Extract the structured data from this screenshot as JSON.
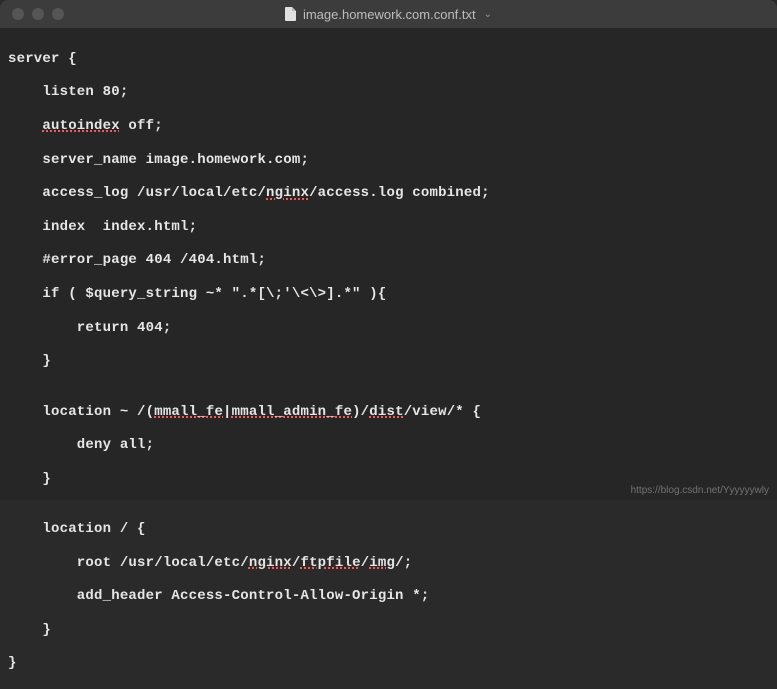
{
  "titlebar": {
    "filename": "image.homework.com.conf.txt",
    "chevron": "⌄"
  },
  "code": {
    "l0": "server {",
    "l1a": "    listen 80;",
    "l2a": "    ",
    "l2b": "autoindex",
    "l2c": " off;",
    "l3a": "    server_name image.homework.com;",
    "l4a": "    access_log /usr/local/etc/",
    "l4b": "nginx",
    "l4c": "/access.log combined;",
    "l5a": "    index  index.html;",
    "l6a": "    #error_page 404 /404.html;",
    "l7a": "    if ( $query_string ~* \".*[\\;'\\<\\>].*\" ){",
    "l8a": "        return 404;",
    "l9a": "    }",
    "l10": "",
    "l11a": "    location ~ /(",
    "l11b": "mmall_fe",
    "l11c": "|",
    "l11d": "mmall_admin_fe",
    "l11e": ")/",
    "l11f": "dist",
    "l11g": "/view/* {",
    "l12a": "        deny all;",
    "l13a": "    }",
    "l14": "",
    "l15a": "    location / {",
    "l16a": "        root /usr/local/etc/",
    "l16b": "nginx",
    "l16c": "/",
    "l16d": "ftpfile",
    "l16e": "/",
    "l16f": "img",
    "l16g": "/;",
    "l17a": "        add_header Access-Control-Allow-Origin *;",
    "l18a": "    }",
    "l19": "}"
  },
  "watermark": "https://blog.csdn.net/Yyyyyywly"
}
